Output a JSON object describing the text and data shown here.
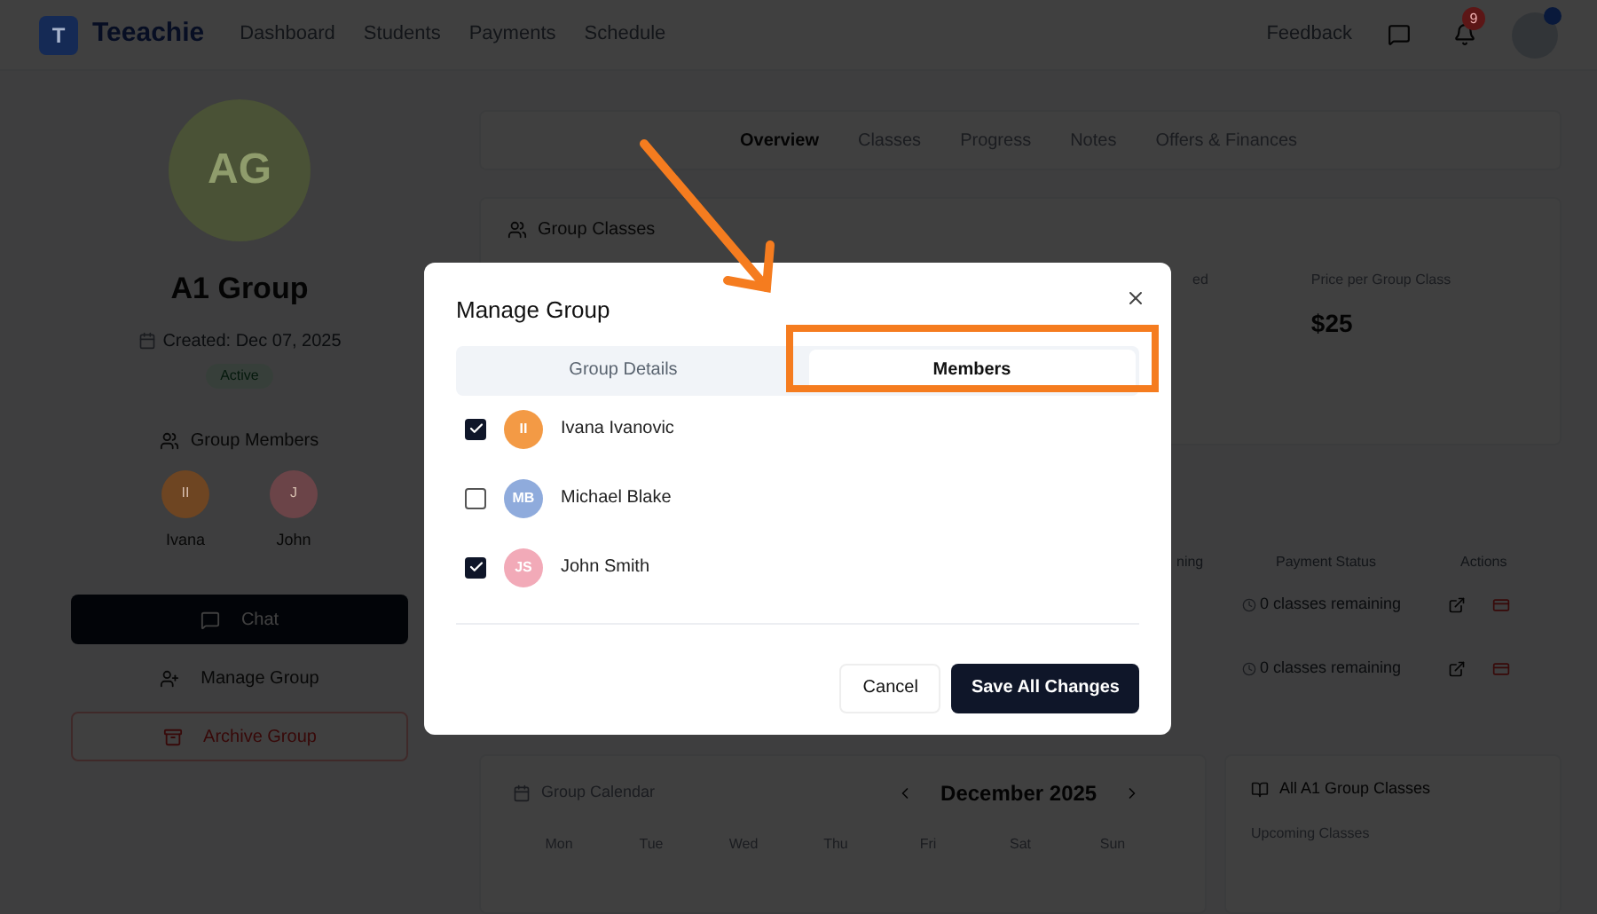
{
  "nav": {
    "brand": "Teeachie",
    "logo_letter": "T",
    "links": [
      "Dashboard",
      "Students",
      "Payments",
      "Schedule"
    ],
    "feedback": "Feedback",
    "notification_count": "9"
  },
  "profile": {
    "initials": "AG",
    "name": "A1 Group",
    "created": "Created: Dec 07, 2025",
    "status": "Active",
    "members_title": "Group Members",
    "members": [
      {
        "initials": "II",
        "name": "Ivana",
        "color": "#6e4522"
      },
      {
        "initials": "J",
        "name": "John",
        "color": "#6b4448"
      }
    ],
    "chat": "Chat",
    "manage": "Manage Group",
    "archive": "Archive Group"
  },
  "tabs": [
    {
      "label": "Overview",
      "selected": true
    },
    {
      "label": "Classes",
      "selected": false
    },
    {
      "label": "Progress",
      "selected": false
    },
    {
      "label": "Notes",
      "selected": false
    },
    {
      "label": "Offers & Finances",
      "selected": false
    }
  ],
  "group_classes": {
    "title": "Group Classes",
    "stat_1_label": "ed",
    "price_label": "Price per Group Class",
    "price": "$25"
  },
  "table": {
    "columns": [
      "ning",
      "Payment Status",
      "Actions"
    ],
    "rows": [
      {
        "payment_status": "0 classes remaining"
      },
      {
        "payment_status": "0 classes remaining"
      }
    ]
  },
  "calendar": {
    "title": "Group Calendar",
    "month": "December 2025",
    "days": [
      "Mon",
      "Tue",
      "Wed",
      "Thu",
      "Fri",
      "Sat",
      "Sun"
    ]
  },
  "all_classes": {
    "title": "All A1 Group Classes",
    "subtitle": "Upcoming Classes"
  },
  "modal": {
    "title": "Manage Group",
    "tabs": [
      {
        "label": "Group Details",
        "selected": false
      },
      {
        "label": "Members",
        "selected": true
      }
    ],
    "members": [
      {
        "initials": "II",
        "name": "Ivana Ivanovic",
        "checked": true,
        "color": "#f39a45"
      },
      {
        "initials": "MB",
        "name": "Michael Blake",
        "checked": false,
        "color": "#8fabdc"
      },
      {
        "initials": "JS",
        "name": "John Smith",
        "checked": true,
        "color": "#f2aab8"
      }
    ],
    "cancel": "Cancel",
    "save": "Save All Changes"
  }
}
